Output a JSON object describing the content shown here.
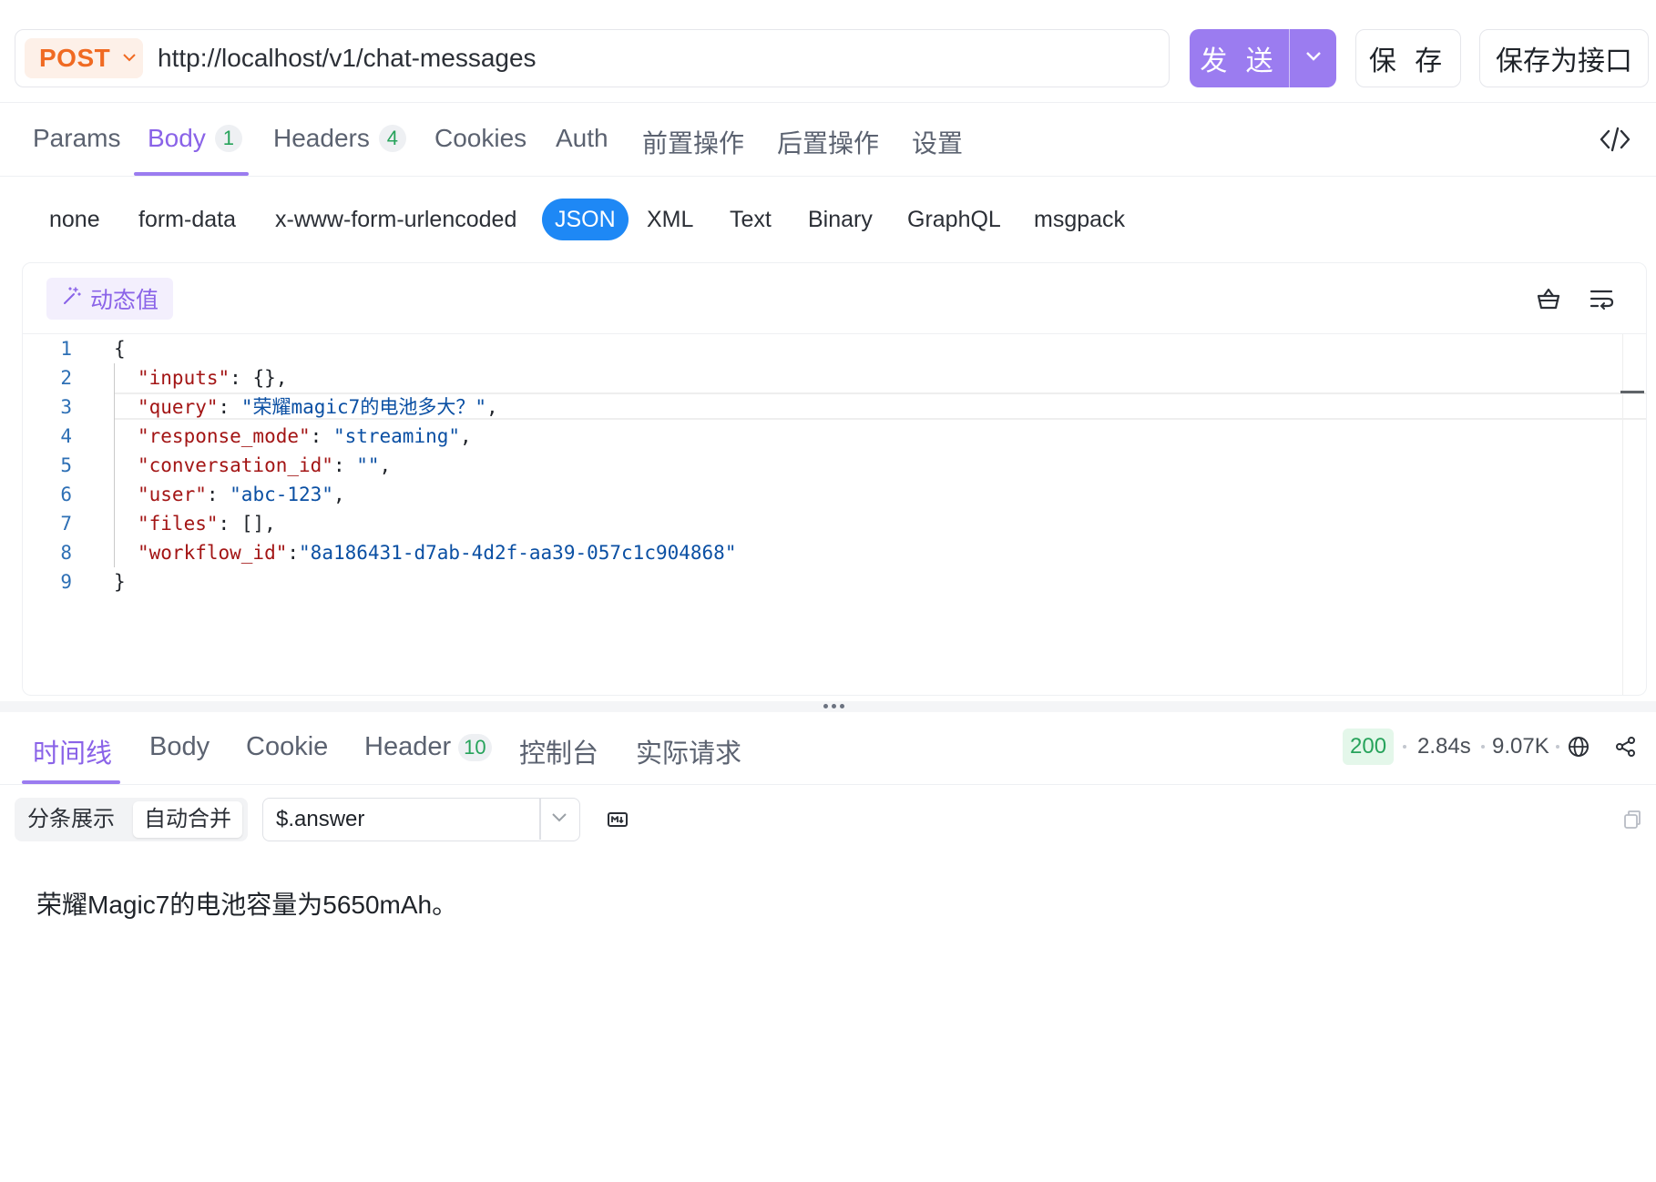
{
  "request": {
    "method": "POST",
    "url": "http://localhost/v1/chat-messages",
    "send_label": "发 送",
    "save_label": "保 存",
    "save_as_api_label": "保存为接口"
  },
  "request_tabs": [
    {
      "label": "Params"
    },
    {
      "label": "Body",
      "badge": "1",
      "active": true
    },
    {
      "label": "Headers",
      "badge": "4"
    },
    {
      "label": "Cookies"
    },
    {
      "label": "Auth"
    },
    {
      "label": "前置操作"
    },
    {
      "label": "后置操作"
    },
    {
      "label": "设置"
    }
  ],
  "body_types": [
    "none",
    "form-data",
    "x-www-form-urlencoded",
    "JSON",
    "XML",
    "Text",
    "Binary",
    "GraphQL",
    "msgpack"
  ],
  "body_type_selected": "JSON",
  "editor": {
    "dynamic_value_label": "动态值",
    "line_numbers": [
      "1",
      "2",
      "3",
      "4",
      "5",
      "6",
      "7",
      "8",
      "9"
    ],
    "lines": [
      {
        "open": "{"
      },
      {
        "key": "\"inputs\"",
        "sep": ": ",
        "value": "{}",
        "tail": ","
      },
      {
        "key": "\"query\"",
        "sep": ": ",
        "value": "\"荣耀magic7的电池多大？\"",
        "tail": ","
      },
      {
        "key": "\"response_mode\"",
        "sep": ": ",
        "value": "\"streaming\"",
        "tail": ","
      },
      {
        "key": "\"conversation_id\"",
        "sep": ": ",
        "value": "\"\"",
        "tail": ","
      },
      {
        "key": "\"user\"",
        "sep": ": ",
        "value": "\"abc-123\"",
        "tail": ","
      },
      {
        "key": "\"files\"",
        "sep": ": ",
        "value": "[]",
        "tail": ","
      },
      {
        "key": "\"workflow_id\"",
        "sep": ":",
        "value": "\"8a186431-d7ab-4d2f-aa39-057c1c904868\"",
        "tail": ""
      },
      {
        "open": "}"
      }
    ]
  },
  "response_tabs": [
    {
      "label": "时间线",
      "active": true
    },
    {
      "label": "Body"
    },
    {
      "label": "Cookie"
    },
    {
      "label": "Header",
      "badge": "10"
    },
    {
      "label": "控制台"
    },
    {
      "label": "实际请求"
    }
  ],
  "response_meta": {
    "status": "200",
    "time": "2.84s",
    "size": "9.07K"
  },
  "response_toolbar": {
    "seg_split": "分条展示",
    "seg_merge": "自动合并",
    "jsonpath": "$.answer"
  },
  "response_output": "荣耀Magic7的电池容量为5650mAh。",
  "colors": {
    "accent": "#9b7cf0",
    "method": "#f06a22",
    "json_selected": "#1e88f5",
    "status_ok": "#27a35b"
  }
}
